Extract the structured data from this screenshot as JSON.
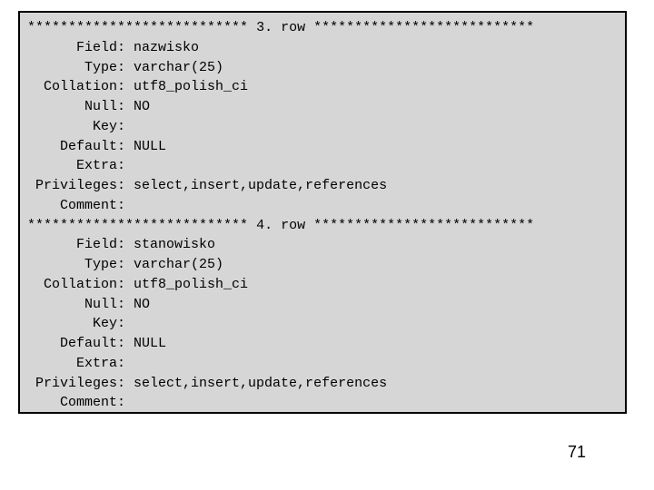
{
  "stars": "***************************",
  "rows": [
    {
      "n": "3",
      "Field": "nazwisko",
      "Type": "varchar(25)",
      "Collation": "utf8_polish_ci",
      "Null": "NO",
      "Key": "",
      "Default": "NULL",
      "Extra": "",
      "Privileges": "select,insert,update,references",
      "Comment": ""
    },
    {
      "n": "4",
      "Field": "stanowisko",
      "Type": "varchar(25)",
      "Collation": "utf8_polish_ci",
      "Null": "NO",
      "Key": "",
      "Default": "NULL",
      "Extra": "",
      "Privileges": "select,insert,update,references",
      "Comment": ""
    }
  ],
  "labels": {
    "Field": "Field",
    "Type": "Type",
    "Collation": "Collation",
    "Null": "Null",
    "Key": "Key",
    "Default": "Default",
    "Extra": "Extra",
    "Privileges": "Privileges",
    "Comment": "Comment",
    "row": "row"
  },
  "pagenum": "71"
}
